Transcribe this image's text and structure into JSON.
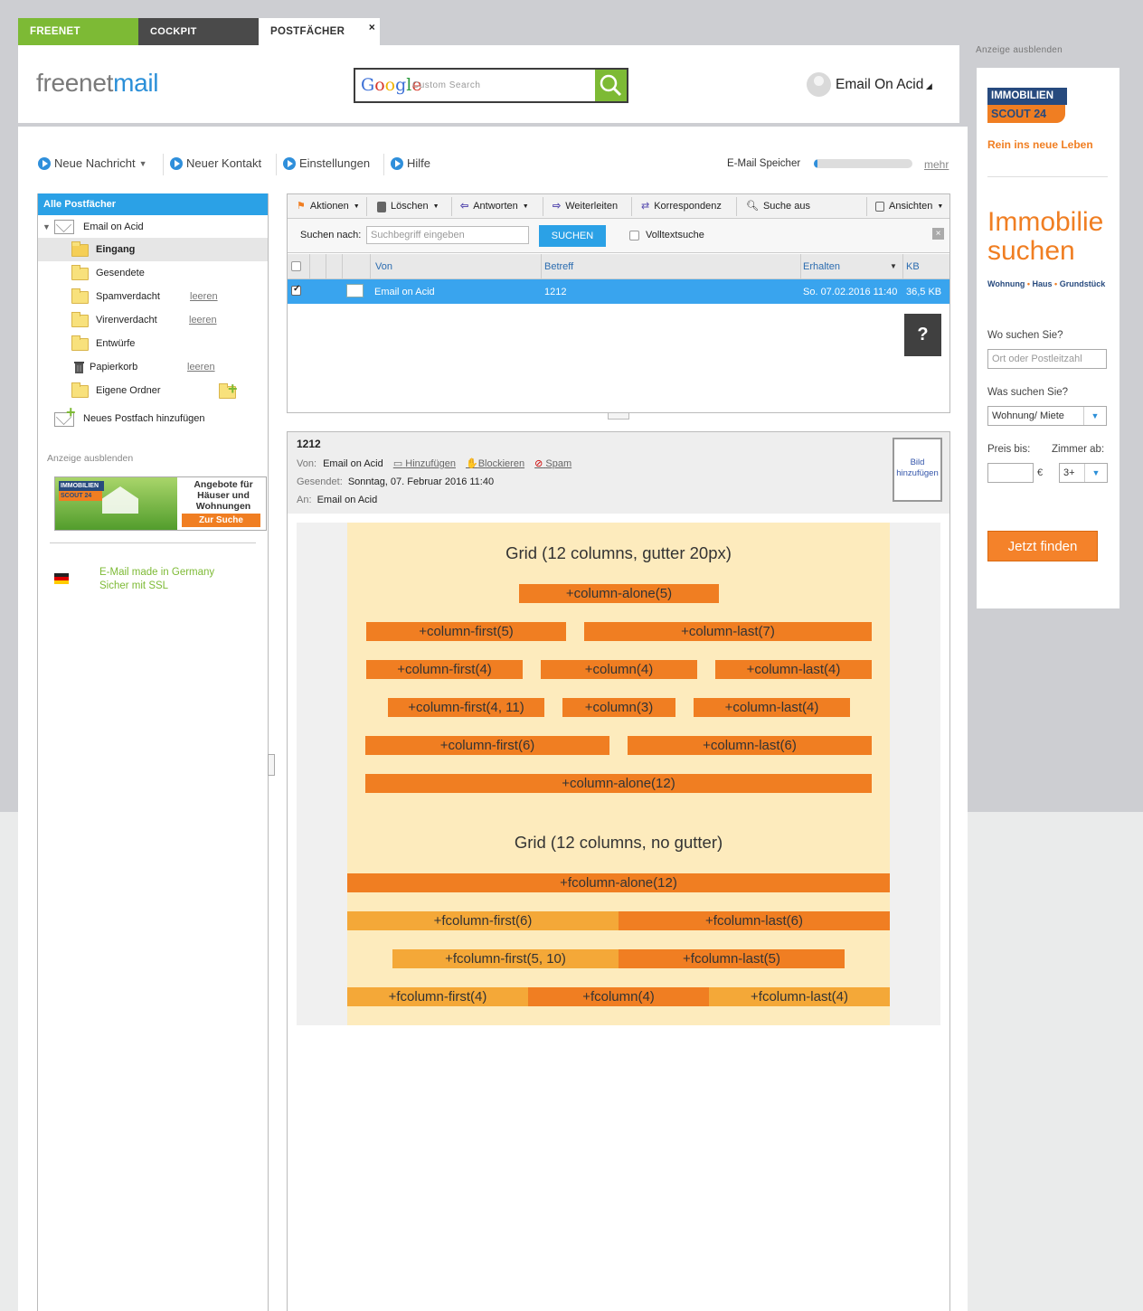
{
  "tabs": [
    "FREENET",
    "COCKPIT",
    "POSTFÄCHER"
  ],
  "tab_close": "×",
  "logo": {
    "part1": "freenet",
    "part2": "mail"
  },
  "search": {
    "brand": "Google",
    "placeholder": "Custom Search"
  },
  "user": {
    "name": "Email On Acid"
  },
  "actions": {
    "new_message": "Neue Nachricht",
    "new_contact": "Neuer Kontakt",
    "settings": "Einstellungen",
    "help": "Hilfe",
    "storage_label": "E-Mail Speicher",
    "storage_fraction": 0.04,
    "more": "mehr"
  },
  "sidebar": {
    "header": "Alle Postfächer",
    "account": "Email on Acid",
    "folders": [
      {
        "label": "Eingang"
      },
      {
        "label": "Gesendete"
      },
      {
        "label": "Spamverdacht",
        "action": "leeren"
      },
      {
        "label": "Virenverdacht",
        "action": "leeren"
      },
      {
        "label": "Entwürfe"
      },
      {
        "label": "Papierkorb",
        "action": "leeren"
      },
      {
        "label": "Eigene Ordner"
      }
    ],
    "add_mailbox": "Neues Postfach hinzufügen",
    "ad_hide": "Anzeige ausblenden",
    "banner": {
      "logo_top": "IMMOBILIEN",
      "logo_bottom": "SCOUT 24",
      "text": "Angebote für Häuser und Wohnungen",
      "button": "Zur Suche"
    },
    "made_in_germany": [
      "E-Mail made in Germany",
      "Sicher mit SSL"
    ]
  },
  "toolbar": {
    "aktionen": "Aktionen",
    "loeschen": "Löschen",
    "antworten": "Antworten",
    "weiterleiten": "Weiterleiten",
    "korrespondenz": "Korrespondenz",
    "suche_aus": "Suche aus",
    "ansichten": "Ansichten"
  },
  "searchbar": {
    "label": "Suchen nach:",
    "placeholder": "Suchbegriff eingeben",
    "button": "SUCHEN",
    "fulltext": "Volltextsuche"
  },
  "columns": {
    "von": "Von",
    "betreff": "Betreff",
    "erhalten": "Erhalten",
    "kb": "KB"
  },
  "messages": [
    {
      "from": "Email on Acid",
      "subject": "1212",
      "received": "So. 07.02.2016 11:40",
      "size": "36,5 KB",
      "checked": true
    }
  ],
  "help_button": "?",
  "reader": {
    "subject": "1212",
    "from_label": "Von:",
    "from": "Email on Acid",
    "add": "Hinzufügen",
    "block": "Blockieren",
    "spam": "Spam",
    "sent_label": "Gesendet:",
    "sent": "Sonntag, 07. Februar 2016 11:40",
    "to_label": "An:",
    "to": "Email on Acid",
    "picture": [
      "Bild",
      "hinzufügen"
    ]
  },
  "grid_content": {
    "title1": "Grid (12 columns, gutter 20px)",
    "row1": [
      "+column-alone(5)"
    ],
    "row2": [
      "+column-first(5)",
      "+column-last(7)"
    ],
    "row3": [
      "+column-first(4)",
      "+column(4)",
      "+column-last(4)"
    ],
    "row4": [
      "+column-first(4, 11)",
      "+column(3)",
      "+column-last(4)"
    ],
    "row5": [
      "+column-first(6)",
      "+column-last(6)"
    ],
    "row6": [
      "+column-alone(12)"
    ],
    "title2": "Grid (12 columns, no gutter)",
    "frow1": [
      "+fcolumn-alone(12)"
    ],
    "frow2": [
      "+fcolumn-first(6)",
      "+fcolumn-last(6)"
    ],
    "frow3": [
      "+fcolumn-first(5, 10)",
      "+fcolumn-last(5)"
    ],
    "frow4": [
      "+fcolumn-first(4)",
      "+fcolumn(4)",
      "+fcolumn-last(4)"
    ]
  },
  "right_ad": {
    "hide": "Anzeige ausblenden",
    "logo_top": "IMMOBILIEN",
    "logo_bottom": "SCOUT 24",
    "tagline": "Rein ins neue Leben",
    "headline1": "Immobilie",
    "headline2": "suchen",
    "types": [
      "Wohnung",
      "Haus",
      "Grundstück"
    ],
    "where_label": "Wo suchen Sie?",
    "where_placeholder": "Ort oder Postleitzahl",
    "what_label": "Was suchen Sie?",
    "what_value": "Wohnung/ Miete",
    "price_label": "Preis bis:",
    "currency": "€",
    "rooms_label": "Zimmer ab:",
    "rooms_value": "3+",
    "button": "Jetzt finden"
  },
  "colors": {
    "green": "#7dba35",
    "blue": "#2ba1e6",
    "orange": "#f07e22",
    "light_orange": "#f4a838",
    "grid_bg": "#fdebbd"
  }
}
